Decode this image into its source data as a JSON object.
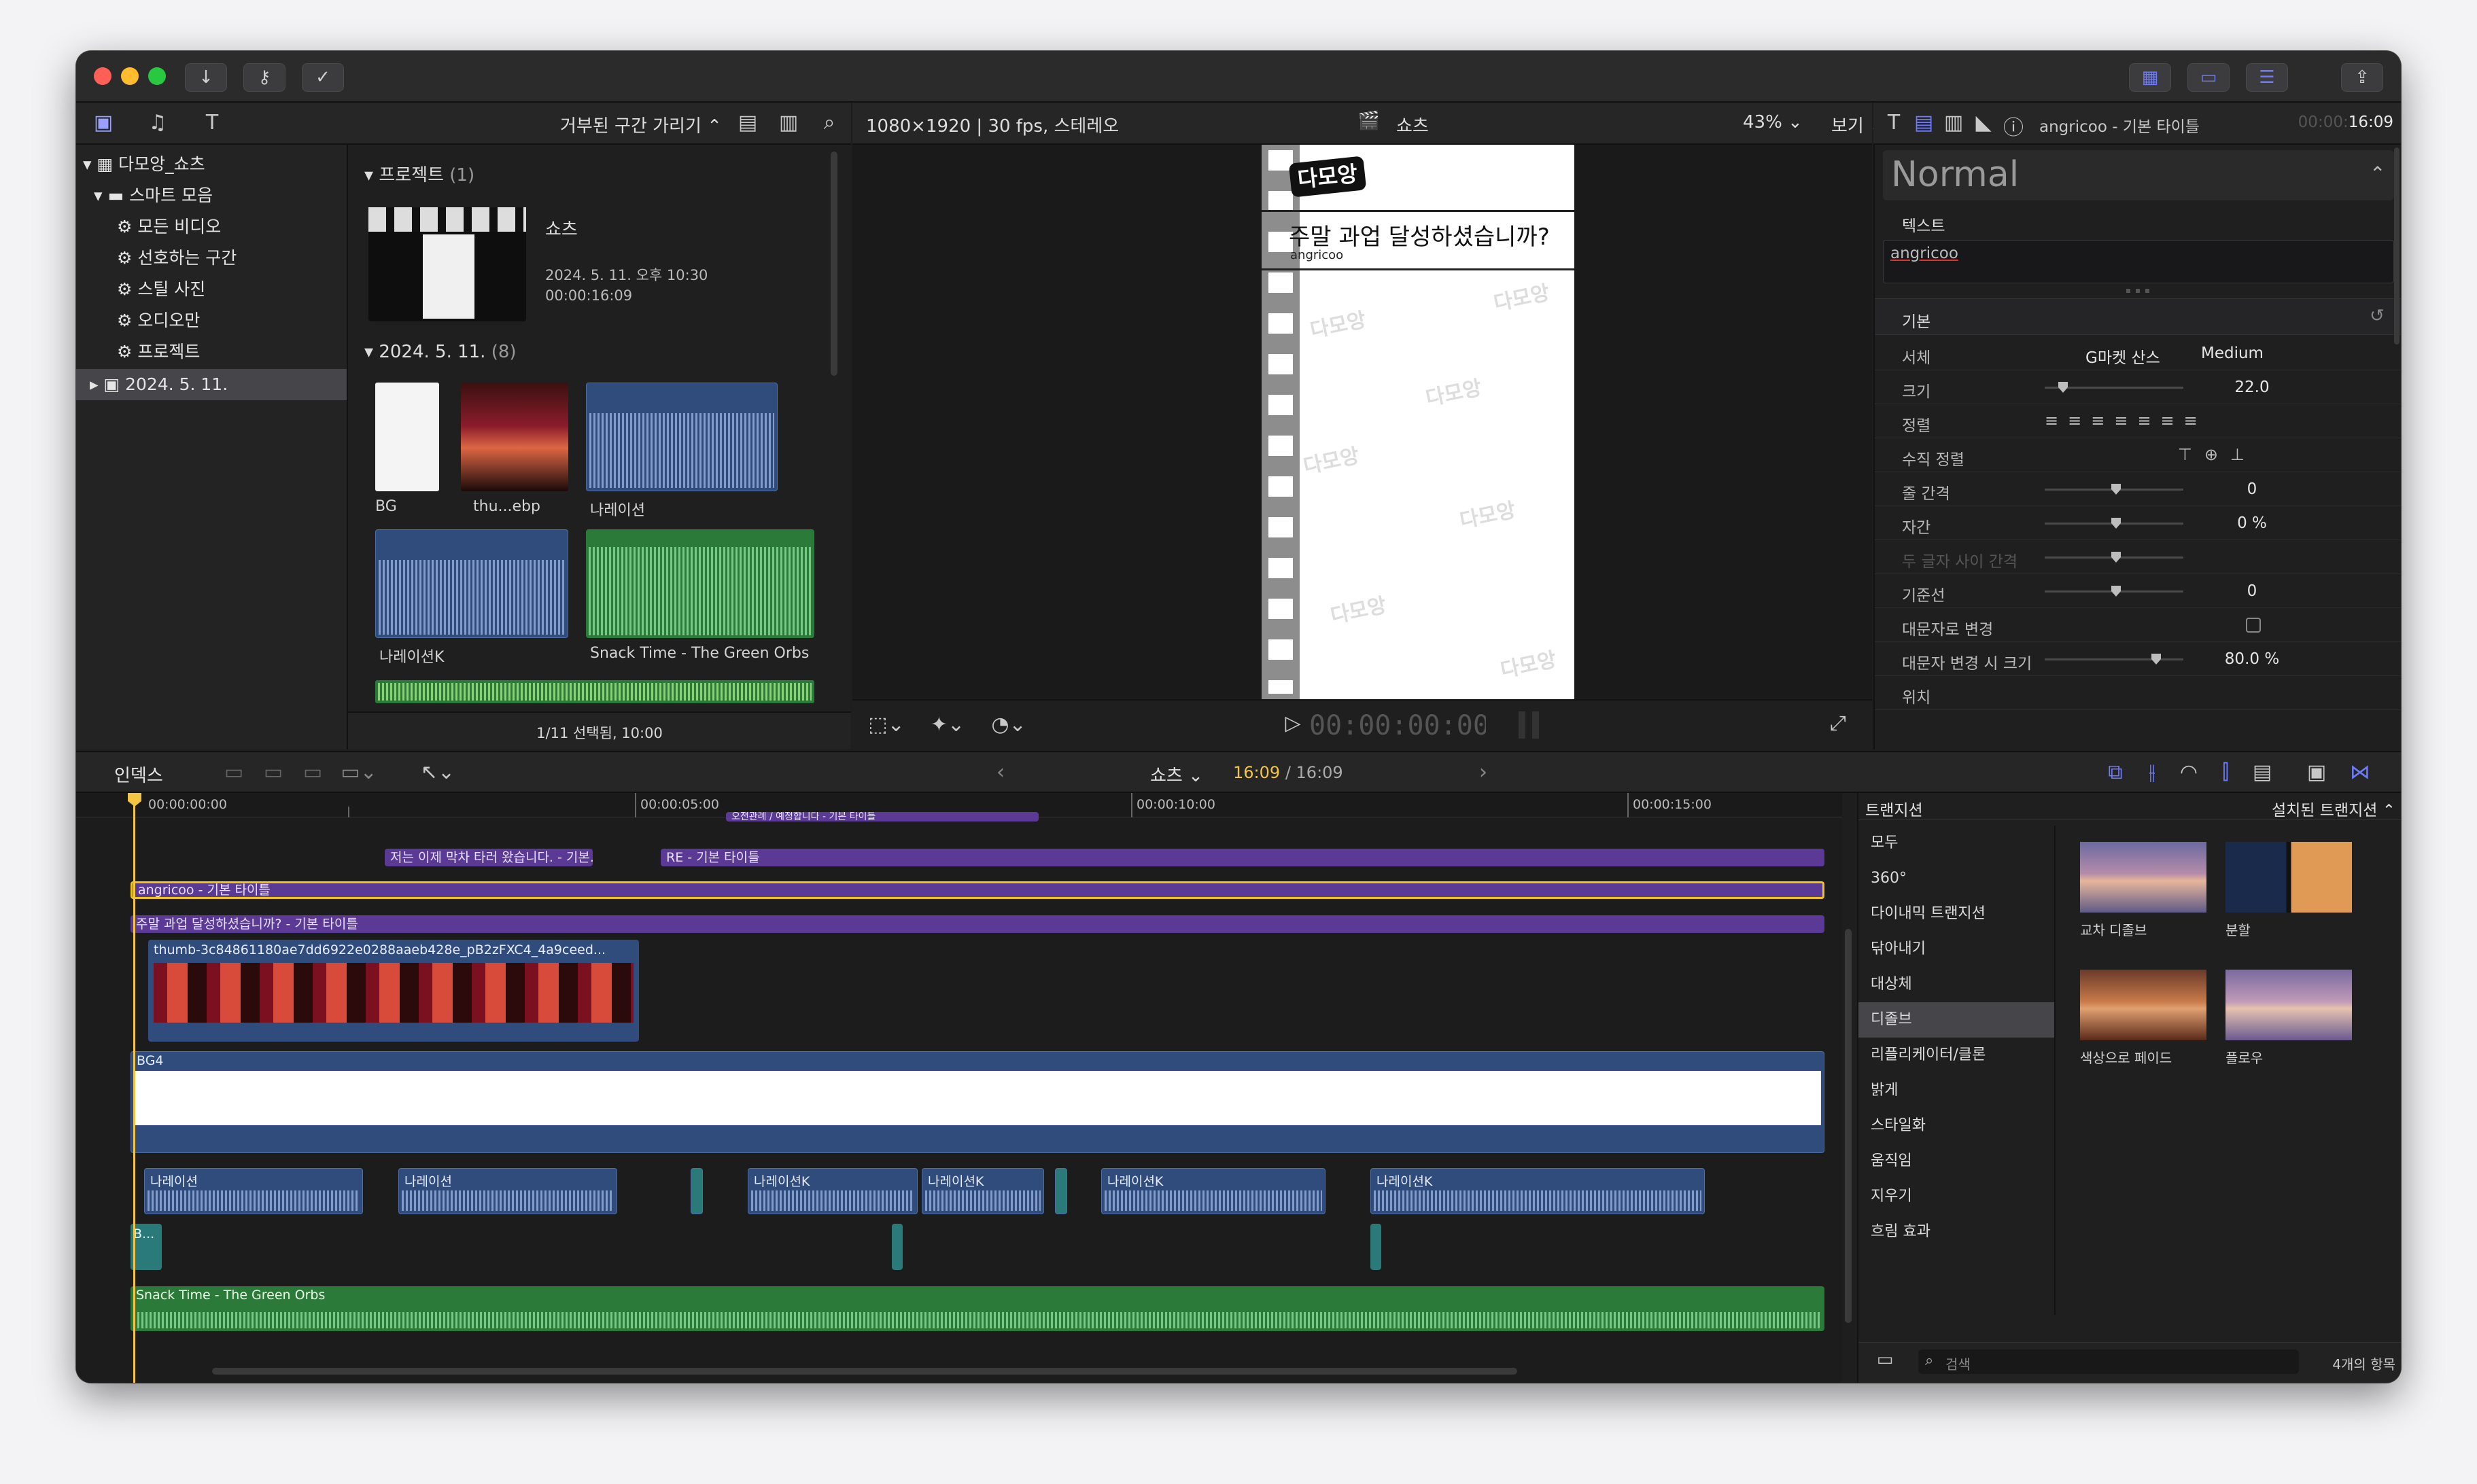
{
  "toolbar": {
    "import_icon": "download-icon",
    "keyword_icon": "key-icon",
    "background_tasks_icon": "checkmark-circle-icon",
    "share_icon": "share-icon"
  },
  "library": {
    "root": "다모앙_쇼츠",
    "smart_folder": "스마트 모음",
    "items": [
      "모든 비디오",
      "선호하는 구간",
      "스틸 사진",
      "오디오만",
      "프로젝트"
    ],
    "event": "2024. 5. 11."
  },
  "browser": {
    "filter": "거부된 구간 가리기",
    "section_projects": "프로젝트",
    "section_projects_count": "(1)",
    "project_name": "쇼츠",
    "project_date": "2024. 5. 11. 오후 10:30",
    "project_duration": "00:00:16:09",
    "section_date": "2024. 5. 11.",
    "section_date_count": "(8)",
    "clips": [
      "BG",
      "thu...ebp",
      "나레이션",
      "나레이션K",
      "Snack Time - The Green Orbs"
    ],
    "status": "1/11 선택됨, 10:00"
  },
  "viewer": {
    "format": "1080×1920 | 30 fps, 스테레오",
    "project": "쇼츠",
    "zoom": "43%",
    "view_label": "보기",
    "logo_text": "다모앙",
    "title_text": "주말 과업 달성하셨습니까?",
    "subtitle_text": "angricoo",
    "timecode": "00:00:00:00"
  },
  "inspector": {
    "clip_title": "angricoo - 기본 타이틀",
    "timecode_dim": "00:00:",
    "timecode": "16:09",
    "preset": "Normal",
    "text_section": "텍스트",
    "text_value": "angricoo",
    "basic_section": "기본",
    "rows": [
      {
        "label": "서체",
        "value": "G마켓 산스",
        "value2": "Medium"
      },
      {
        "label": "크기",
        "value": "22.0",
        "slider": 0.1
      },
      {
        "label": "정렬",
        "value": ""
      },
      {
        "label": "수직 정렬",
        "value": ""
      },
      {
        "label": "줄 간격",
        "value": "0",
        "slider": 0.5
      },
      {
        "label": "자간",
        "value": "0 %",
        "slider": 0.5
      },
      {
        "label": "두 글자 사이 간격",
        "value": "",
        "slider": 0.5,
        "dim": true
      },
      {
        "label": "기준선",
        "value": "0",
        "slider": 0.5
      },
      {
        "label": "대문자로 변경",
        "value": ""
      },
      {
        "label": "대문자 변경 시 크기",
        "value": "80.0 %",
        "slider": 0.8
      },
      {
        "label": "위치",
        "value": ""
      }
    ]
  },
  "timeline": {
    "index_label": "인덱스",
    "project": "쇼츠",
    "time_current": "16:09",
    "time_total": "/ 16:09",
    "ruler": [
      "00:00:00:00",
      "00:00:05:00",
      "00:00:10:00",
      "00:00:15:00"
    ],
    "titles": {
      "top_clip": "오전관례 / 예정합니다 - 기본 타이틀",
      "clip1": "저는 이제 막차 타러 왔습니다. - 기본...",
      "clip2": "RE - 기본 타이틀",
      "clip3": "angricoo - 기본 타이틀",
      "clip4": "주말 과업 달성하셨습니까? - 기본 타이틀"
    },
    "video_clip": "thumb-3c84861180ae7dd6922e0288aaeb428e_pB2zFXC4_4a9ceed...",
    "bg_clip": "BG4",
    "audio_clips": [
      "나레이션",
      "나레이션",
      "나레이션K",
      "나레이션K",
      "나레이션K",
      "나레이션K"
    ],
    "small_clip": "B...",
    "music_clip": "Snack Time - The Green Orbs"
  },
  "transitions": {
    "header": "트랜지션",
    "installed": "설치된 트랜지션",
    "categories": [
      "모두",
      "360°",
      "다이내믹 트랜지션",
      "닦아내기",
      "대상체",
      "디졸브",
      "리플리케이터/클론",
      "밝게",
      "스타일화",
      "움직임",
      "지우기",
      "흐림 효과"
    ],
    "selected": "디졸브",
    "items": [
      "교차 디졸브",
      "분할",
      "색상으로 페이드",
      "플로우"
    ],
    "search_placeholder": "검색",
    "count": "4개의 항목"
  },
  "colors": {
    "title_track": "#5b3a96",
    "selected_outline": "#f1c40f",
    "audio": "#2f4c7c",
    "music": "#2c7a3a",
    "playhead": "#f4c542",
    "accent": "#6e7bff"
  }
}
